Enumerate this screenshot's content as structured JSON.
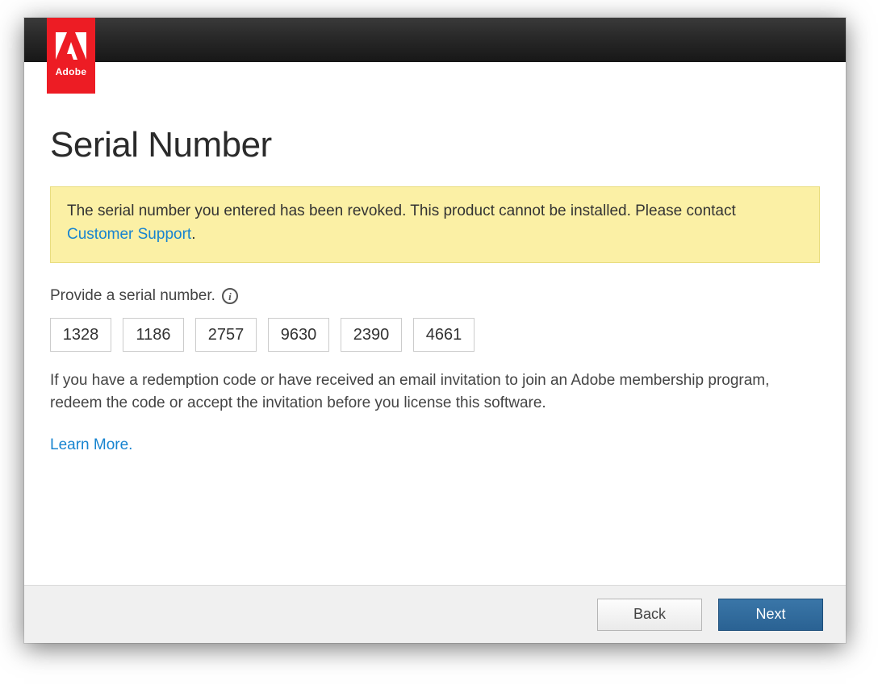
{
  "brand": {
    "name": "Adobe"
  },
  "page": {
    "title": "Serial Number"
  },
  "alert": {
    "text_before": "The serial number you entered has been revoked. This product cannot be installed. Please contact ",
    "link_text": "Customer Support",
    "text_after": "."
  },
  "prompt": {
    "label": "Provide a serial number."
  },
  "serial": {
    "fields": [
      "1328",
      "1186",
      "2757",
      "9630",
      "2390",
      "4661"
    ]
  },
  "help": {
    "text": "If you have a redemption code or have received an email invitation to join an Adobe membership program, redeem the code or accept the invitation before you license this software."
  },
  "links": {
    "learn_more": "Learn More."
  },
  "footer": {
    "back": "Back",
    "next": "Next"
  }
}
